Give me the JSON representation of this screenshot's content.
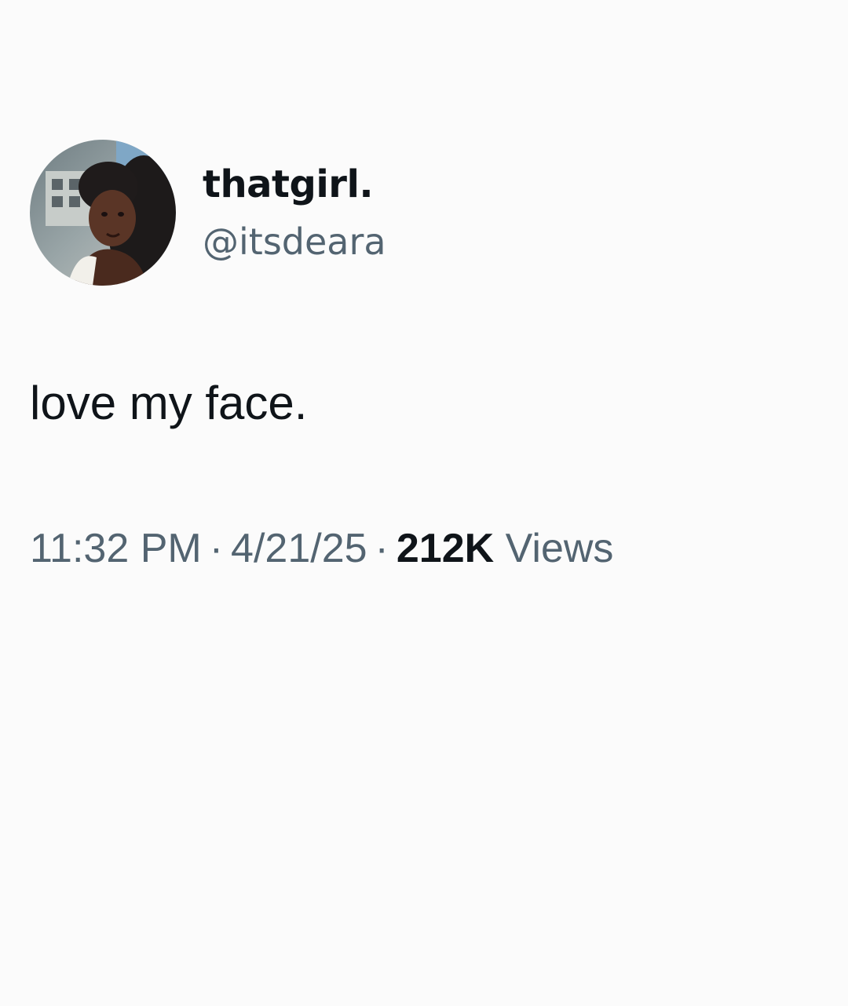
{
  "author": {
    "display_name": "thatgirl.",
    "handle": "@itsdeara",
    "avatar_icon": "profile-photo"
  },
  "tweet": {
    "text": "love my face.",
    "time": "11:32 PM",
    "date": "4/21/25",
    "separator": "·",
    "views_count": "212K",
    "views_label": "Views"
  },
  "colors": {
    "background": "#fbfbfb",
    "primary_text": "#0f1419",
    "secondary_text": "#536471"
  }
}
